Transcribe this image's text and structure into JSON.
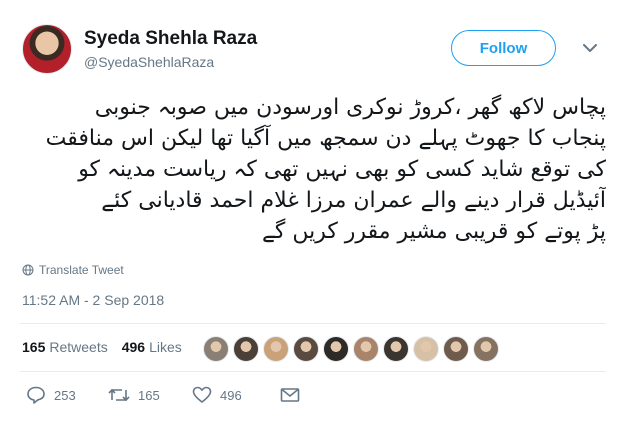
{
  "author": {
    "name": "Syeda Shehla Raza",
    "handle": "@SyedaShehlaRaza"
  },
  "follow_label": "Follow",
  "tweet": {
    "lines": [
      "پچاس لاکھ گھر ،کروڑ نوکری اورسودن میں صوبہ جنوبی",
      "پنجاب کا جھوٹ پہلے دن سمجھ میں آگیا تھا لیکن اس منافقت",
      "کی توقع شاید کسی کو بھی نہیں تھی کہ ریاست مدینہ کو",
      "آئیڈیل قرار دینے والے عمران مرزا غلام احمد قادیانی کئے",
      "پڑ پوتے کو قریبی مشیر مقرر کریں گے"
    ]
  },
  "translate_label": "Translate Tweet",
  "timestamp": "11:52 AM - 2 Sep 2018",
  "stats": {
    "retweets_count": "165",
    "retweets_label": "Retweets",
    "likes_count": "496",
    "likes_label": "Likes"
  },
  "liker_avatar_colors": [
    "#8a7f74",
    "#4a4038",
    "#c9a27a",
    "#5b4a3f",
    "#2d2a28",
    "#a8856a",
    "#3b3530",
    "#d6c1a6",
    "#6e5b4b",
    "#867261"
  ],
  "actions": {
    "replies": "253",
    "retweets": "165",
    "likes": "496"
  },
  "colors": {
    "accent": "#1da1f2",
    "secondary_text": "#657786"
  }
}
